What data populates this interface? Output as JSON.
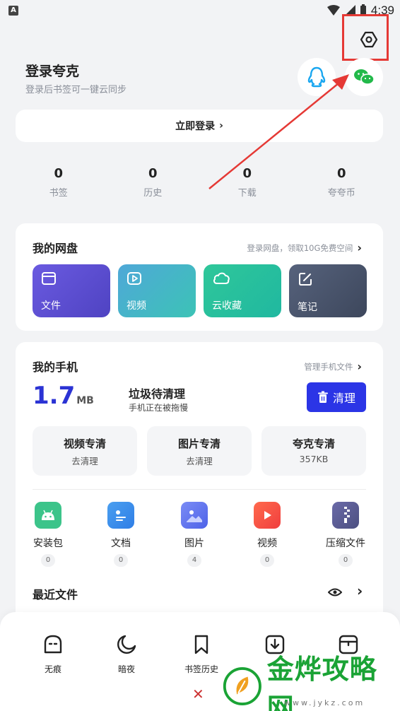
{
  "status_bar": {
    "time": "4:39"
  },
  "header": {
    "title": "登录夸克",
    "subtitle": "登录后书签可一键云同步",
    "login_button": "立即登录"
  },
  "stats": [
    {
      "count": "0",
      "label": "书签"
    },
    {
      "count": "0",
      "label": "历史"
    },
    {
      "count": "0",
      "label": "下载"
    },
    {
      "count": "0",
      "label": "夸夸币"
    }
  ],
  "cloud": {
    "title": "我的网盘",
    "link": "登录网盘，领取10G免费空间",
    "tiles": [
      {
        "label": "文件",
        "color": "#5b4fd6"
      },
      {
        "label": "视频",
        "color": "#3fb3c2"
      },
      {
        "label": "云收藏",
        "color": "#27c29a"
      },
      {
        "label": "笔记",
        "color": "#4a5670"
      }
    ]
  },
  "phone": {
    "title": "我的手机",
    "link": "管理手机文件",
    "junk_size": "1.7",
    "junk_unit": "MB",
    "junk_title": "垃圾待清理",
    "junk_sub": "手机正在被拖慢",
    "clean_button": "清理",
    "clean_tiles": [
      {
        "title": "视频专清",
        "sub": "去清理"
      },
      {
        "title": "图片专清",
        "sub": "去清理"
      },
      {
        "title": "夸克专清",
        "sub": "357KB"
      }
    ],
    "categories": [
      {
        "label": "安装包",
        "count": "0"
      },
      {
        "label": "文档",
        "count": "0"
      },
      {
        "label": "图片",
        "count": "4"
      },
      {
        "label": "视频",
        "count": "0"
      },
      {
        "label": "压缩文件",
        "count": "0"
      }
    ],
    "recent_title": "最近文件"
  },
  "bottom_nav": [
    {
      "label": "无痕"
    },
    {
      "label": "暗夜"
    },
    {
      "label": "书签历史"
    },
    {
      "label": ""
    },
    {
      "label": ""
    }
  ],
  "watermark": {
    "text": "金烨攻略网",
    "url": "www.jykz.com"
  },
  "colors": {
    "accent": "#2b33d4",
    "highlight": "#e53935"
  }
}
